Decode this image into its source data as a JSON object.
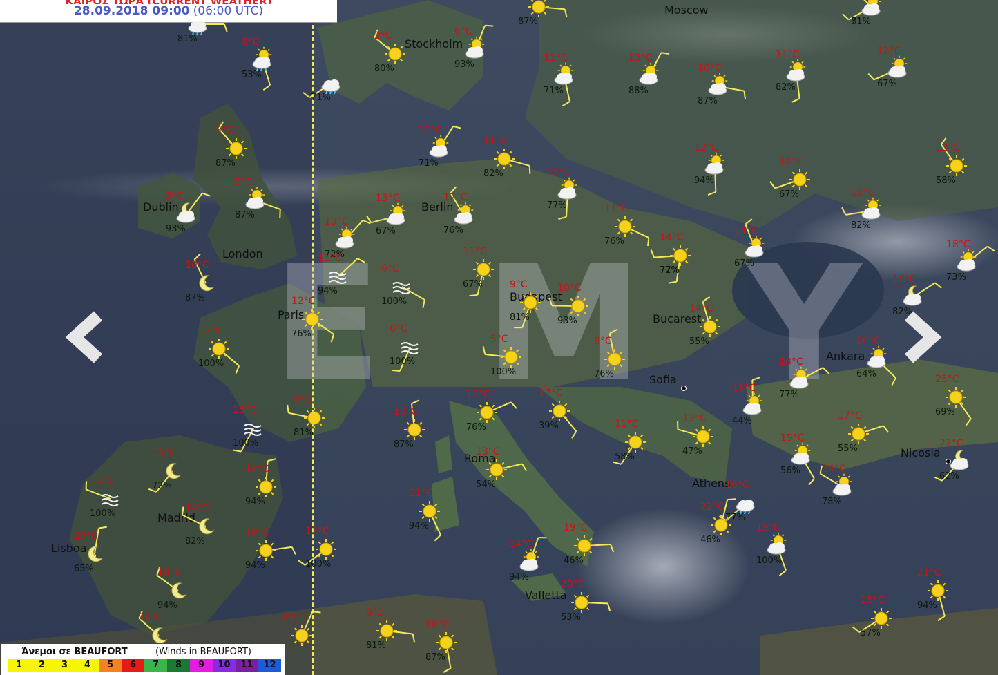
{
  "header": {
    "title": "ΚΑΙΡΟΣ ΤΩΡΑ (CURRENT WEATHER)",
    "date": "28.09.2018 09:00",
    "utc": "(06:00 UTC)"
  },
  "watermark": "EMY",
  "colors": {
    "temperature": "#c81414",
    "humidity": "#0c1a0c",
    "wind_barb": "#f3e95a",
    "terminator": "#f3e95a",
    "header_date": "#4a57c8",
    "header_title": "#e02222"
  },
  "navigation": {
    "prev_icon": "chevron-left-icon",
    "next_icon": "chevron-right-icon"
  },
  "cities": [
    {
      "name": "Moscow"
    },
    {
      "name": "Stockholm"
    },
    {
      "name": "Berlin"
    },
    {
      "name": "Dublin"
    },
    {
      "name": "London"
    },
    {
      "name": "Paris"
    },
    {
      "name": "Budapest"
    },
    {
      "name": "Bucarest"
    },
    {
      "name": "Ankara"
    },
    {
      "name": "Sofia"
    },
    {
      "name": "Roma"
    },
    {
      "name": "Madrid"
    },
    {
      "name": "Lisboa"
    },
    {
      "name": "Athens"
    },
    {
      "name": "Nicosia"
    },
    {
      "name": "Valletta"
    }
  ],
  "stations": [
    {
      "temp": "",
      "hum": "81%",
      "icon": "cloud-rain-icon"
    },
    {
      "temp": "8°C",
      "hum": "53%",
      "icon": "sun-cloud-rain-icon"
    },
    {
      "temp": "",
      "hum": "71%",
      "icon": "cloud-rain-icon"
    },
    {
      "temp": "2°C",
      "hum": "80%",
      "icon": "sun-icon"
    },
    {
      "temp": "6°C",
      "hum": "93%",
      "icon": "sun-cloud-icon"
    },
    {
      "temp": "",
      "hum": "87%",
      "icon": "sun-icon"
    },
    {
      "temp": "11°C",
      "hum": "71%",
      "icon": "sun-cloud-icon"
    },
    {
      "temp": "",
      "hum": "81%",
      "icon": "sun-cloud-icon"
    },
    {
      "temp": "",
      "hum": "71%",
      "icon": "sun-cloud-icon"
    },
    {
      "temp": "13°C",
      "hum": "88%",
      "icon": "sun-cloud-icon"
    },
    {
      "temp": "10°C",
      "hum": "87%",
      "icon": "sun-cloud-icon"
    },
    {
      "temp": "11°C",
      "hum": "82%",
      "icon": "sun-cloud-icon"
    },
    {
      "temp": "12°C",
      "hum": "67%",
      "icon": "sun-cloud-icon"
    },
    {
      "temp": "5°C",
      "hum": "87%",
      "icon": "sun-icon"
    },
    {
      "temp": "11°C",
      "hum": "71%",
      "icon": "sun-cloud-icon"
    },
    {
      "temp": "11°C",
      "hum": "82%",
      "icon": "sun-icon"
    },
    {
      "temp": "12°C",
      "hum": "94%",
      "icon": "sun-cloud-icon"
    },
    {
      "temp": "14°C",
      "hum": "67%",
      "icon": "sun-icon"
    },
    {
      "temp": "13°C",
      "hum": "58%",
      "icon": "sun-icon"
    },
    {
      "temp": "3°C",
      "hum": "93%",
      "icon": "moon-cloud-icon"
    },
    {
      "temp": "5°C",
      "hum": "87%",
      "icon": "sun-cloud-icon"
    },
    {
      "temp": "15°C",
      "hum": "77%",
      "icon": "sun-cloud-icon"
    },
    {
      "temp": "13°C",
      "hum": "67%",
      "icon": "sun-cloud-icon"
    },
    {
      "temp": "12°C",
      "hum": "76%",
      "icon": "sun-cloud-icon"
    },
    {
      "temp": "13°C",
      "hum": "72%",
      "icon": "sun-cloud-icon"
    },
    {
      "temp": "11°C",
      "hum": "76%",
      "icon": "sun-icon"
    },
    {
      "temp": "14°C",
      "hum": "77%",
      "icon": "sun-icon"
    },
    {
      "temp": "12°C",
      "hum": "82%",
      "icon": "sun-cloud-icon"
    },
    {
      "temp": "10°C",
      "hum": "87%",
      "icon": "moon-icon"
    },
    {
      "temp": "11°C",
      "hum": "94%",
      "icon": "fog-icon"
    },
    {
      "temp": "6°C",
      "hum": "100%",
      "icon": "fog-icon"
    },
    {
      "temp": "11°C",
      "hum": "67%",
      "icon": "sun-icon"
    },
    {
      "temp": "14°C",
      "hum": "72%",
      "icon": "sun-icon"
    },
    {
      "temp": "14°C",
      "hum": "67%",
      "icon": "sun-cloud-icon"
    },
    {
      "temp": "18°C",
      "hum": "73%",
      "icon": "sun-cloud-icon"
    },
    {
      "temp": "12°C",
      "hum": "76%",
      "icon": "sun-icon"
    },
    {
      "temp": "9°C",
      "hum": "81%",
      "icon": "sun-icon"
    },
    {
      "temp": "10°C",
      "hum": "93%",
      "icon": "sun-icon"
    },
    {
      "temp": "14°C",
      "hum": "55%",
      "icon": "sun-icon"
    },
    {
      "temp": "16°C",
      "hum": "82%",
      "icon": "moon-cloud-icon"
    },
    {
      "temp": "12°C",
      "hum": "100%",
      "icon": "sun-icon"
    },
    {
      "temp": "6°C",
      "hum": "100%",
      "icon": "fog-icon"
    },
    {
      "temp": "5°C",
      "hum": "100%",
      "icon": "sun-icon"
    },
    {
      "temp": "8°C",
      "hum": "76%",
      "icon": "sun-icon"
    },
    {
      "temp": "18°C",
      "hum": "77%",
      "icon": "sun-cloud-icon"
    },
    {
      "temp": "20°C",
      "hum": "64%",
      "icon": "sun-cloud-icon"
    },
    {
      "temp": "15°C",
      "hum": "100%",
      "icon": "fog-icon"
    },
    {
      "temp": "9°C",
      "hum": "81%",
      "icon": "sun-icon"
    },
    {
      "temp": "10°C",
      "hum": "87%",
      "icon": "sun-icon"
    },
    {
      "temp": "10°C",
      "hum": "76%",
      "icon": "sun-icon"
    },
    {
      "temp": "17°C",
      "hum": "39%",
      "icon": "sun-icon"
    },
    {
      "temp": "11°C",
      "hum": "58%",
      "icon": "sun-icon"
    },
    {
      "temp": "13°C",
      "hum": "47%",
      "icon": "sun-icon"
    },
    {
      "temp": "15°C",
      "hum": "44%",
      "icon": "sun-cloud-icon"
    },
    {
      "temp": "17°C",
      "hum": "55%",
      "icon": "sun-icon"
    },
    {
      "temp": "25°C",
      "hum": "69%",
      "icon": "sun-icon"
    },
    {
      "temp": "15°C",
      "hum": "72%",
      "icon": "moon-icon"
    },
    {
      "temp": "16°C",
      "hum": "100%",
      "icon": "fog-icon"
    },
    {
      "temp": "12°C",
      "hum": "94%",
      "icon": "sun-icon"
    },
    {
      "temp": "13°C",
      "hum": "54%",
      "icon": "sun-icon"
    },
    {
      "temp": "19°C",
      "hum": "56%",
      "icon": "sun-cloud-icon"
    },
    {
      "temp": "27°C",
      "hum": "62%",
      "icon": "moon-cloud-icon"
    },
    {
      "temp": "14°C",
      "hum": "82%",
      "icon": "moon-icon"
    },
    {
      "temp": "23°C",
      "hum": "65%",
      "icon": "moon-icon"
    },
    {
      "temp": "19°C",
      "hum": "94%",
      "icon": "sun-icon"
    },
    {
      "temp": "11°C",
      "hum": "94%",
      "icon": "sun-icon"
    },
    {
      "temp": "16°C",
      "hum": "77%",
      "icon": "cloud-rain-icon"
    },
    {
      "temp": "24°C",
      "hum": "78%",
      "icon": "sun-cloud-icon"
    },
    {
      "temp": "22°C",
      "hum": "46%",
      "icon": "sun-icon"
    },
    {
      "temp": "19°C",
      "hum": "46%",
      "icon": "sun-icon"
    },
    {
      "temp": "19°C",
      "hum": "100%",
      "icon": "sun-cloud-icon"
    },
    {
      "temp": "13°C",
      "hum": "100%",
      "icon": "sun-icon"
    },
    {
      "temp": "18°C",
      "hum": "94%",
      "icon": "moon-icon"
    },
    {
      "temp": "14°C",
      "hum": "94%",
      "icon": "sun-cloud-icon"
    },
    {
      "temp": "20°C",
      "hum": "53%",
      "icon": "sun-icon"
    },
    {
      "temp": "21°C",
      "hum": "94%",
      "icon": "sun-icon"
    },
    {
      "temp": "25°C",
      "hum": "57%",
      "icon": "sun-icon"
    },
    {
      "temp": "23°C",
      "hum": "",
      "icon": "moon-icon"
    },
    {
      "temp": "19°C",
      "hum": "",
      "icon": "sun-icon"
    },
    {
      "temp": "9°C",
      "hum": "81%",
      "icon": "sun-icon"
    },
    {
      "temp": "10°C",
      "hum": "87%",
      "icon": "sun-icon"
    }
  ],
  "legend": {
    "title": "Άνεμοι σε BEAUFORT",
    "subtitle": "(Winds in BEAUFORT)",
    "levels": [
      {
        "label": "1",
        "color": "#f6f600"
      },
      {
        "label": "2",
        "color": "#f6f600"
      },
      {
        "label": "3",
        "color": "#f6f600"
      },
      {
        "label": "4",
        "color": "#f6f600"
      },
      {
        "label": "5",
        "color": "#f58220"
      },
      {
        "label": "6",
        "color": "#e41b17"
      },
      {
        "label": "7",
        "color": "#3ab54a"
      },
      {
        "label": "8",
        "color": "#1a7a33"
      },
      {
        "label": "9",
        "color": "#e31ee0"
      },
      {
        "label": "10",
        "color": "#8a2be2"
      },
      {
        "label": "11",
        "color": "#7b1fa2"
      },
      {
        "label": "12",
        "color": "#1e5bd8"
      }
    ]
  }
}
